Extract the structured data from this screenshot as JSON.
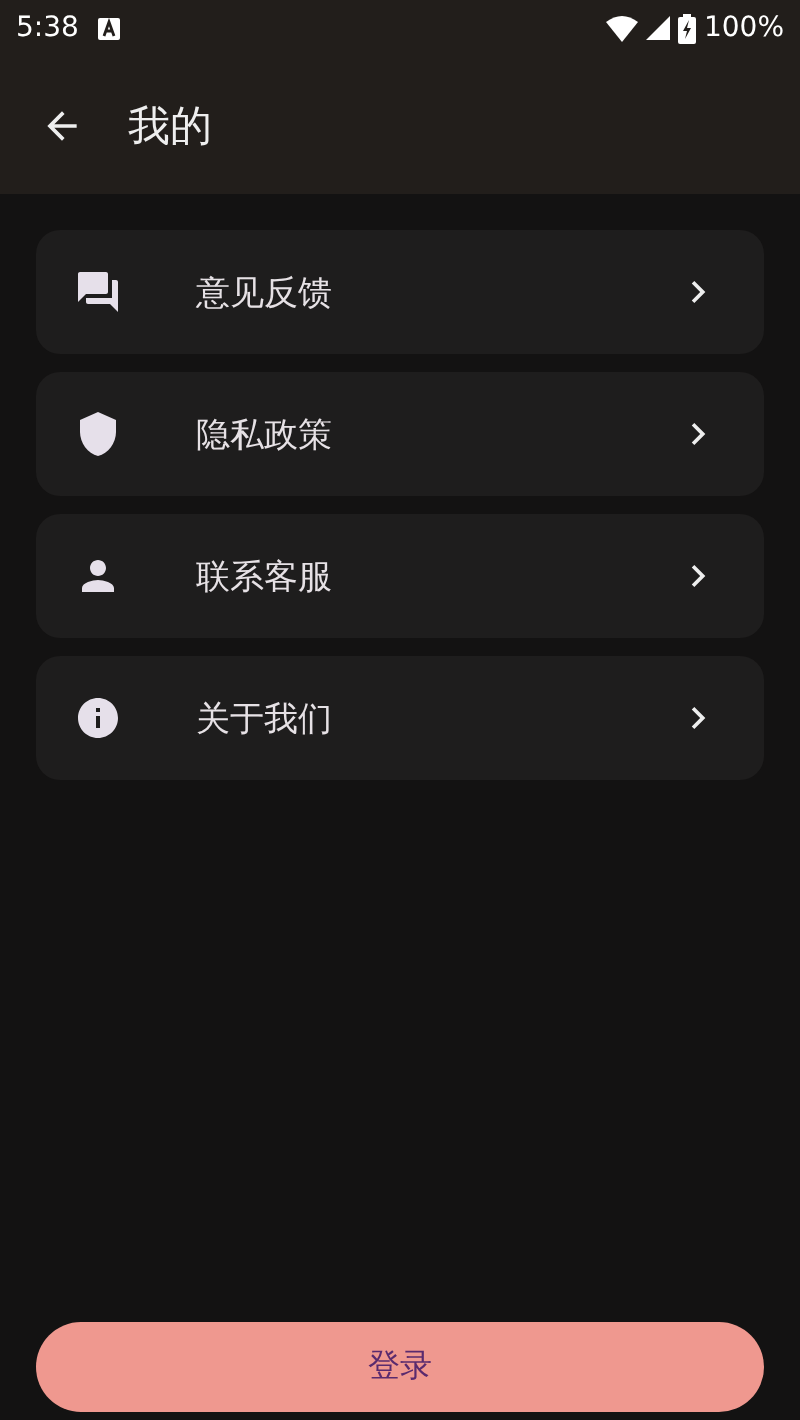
{
  "status_bar": {
    "time": "5:38",
    "battery": "100%"
  },
  "header": {
    "title": "我的"
  },
  "menu": [
    {
      "kind": "chat",
      "label": "意见反馈"
    },
    {
      "kind": "shield",
      "label": "隐私政策"
    },
    {
      "kind": "person",
      "label": "联系客服"
    },
    {
      "kind": "info",
      "label": "关于我们"
    }
  ],
  "login_button": {
    "label": "登录"
  }
}
